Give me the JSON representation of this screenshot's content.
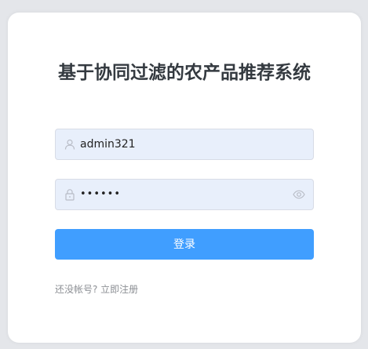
{
  "login": {
    "title": "基于协同过滤的农产品推荐系统",
    "username": {
      "value": "admin321",
      "icon": "user-icon"
    },
    "password": {
      "masked_value": "••••••",
      "prefix_icon": "lock-icon",
      "suffix_icon": "eye-icon"
    },
    "login_button_label": "登录",
    "register_link_label": "还没帐号? 立即注册"
  },
  "colors": {
    "primary": "#409eff",
    "input_background": "#e8effb",
    "page_background": "#e4e6ea",
    "title_text": "#343a40",
    "muted_text": "#8c8f94"
  }
}
